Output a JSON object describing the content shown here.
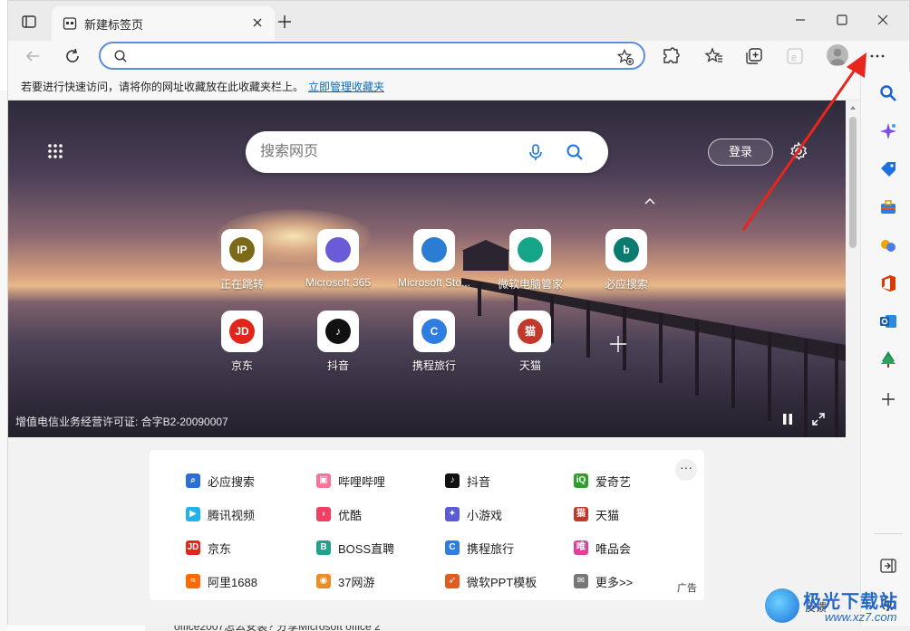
{
  "tab": {
    "title": "新建标签页"
  },
  "addressbar": {
    "value": "",
    "placeholder": ""
  },
  "favorites_hint": {
    "message": "若要进行快速访问，请将你的网址收藏放在此收藏夹栏上。",
    "link": "立即管理收藏夹"
  },
  "search": {
    "placeholder": "搜索网页"
  },
  "login_label": "登录",
  "tiles": [
    {
      "label": "正在跳转",
      "icon": "ip-icon",
      "text": "IP",
      "color": "#7a6a1a"
    },
    {
      "label": "Microsoft 365",
      "icon": "m365-icon",
      "text": "",
      "color": "#6a5cd6"
    },
    {
      "label": "Microsoft Sto...",
      "icon": "store-icon",
      "text": "",
      "color": "#2b7cd3"
    },
    {
      "label": "微软电脑管家",
      "icon": "pc-manager-icon",
      "text": "",
      "color": "#17a589"
    },
    {
      "label": "必应搜索",
      "icon": "bing-icon",
      "text": "b",
      "color": "#0b7a6f"
    },
    {
      "label": "京东",
      "icon": "jd-icon",
      "text": "JD",
      "color": "#e1251b"
    },
    {
      "label": "抖音",
      "icon": "douyin-icon",
      "text": "♪",
      "color": "#111111"
    },
    {
      "label": "携程旅行",
      "icon": "ctrip-icon",
      "text": "C",
      "color": "#2f7de1"
    },
    {
      "label": "天猫",
      "icon": "tmall-icon",
      "text": "猫",
      "color": "#c0392b"
    }
  ],
  "license": "增值电信业务经营许可证: 合字B2-20090007",
  "links": [
    {
      "label": "必应搜索",
      "icon": "search-icon",
      "color": "#2b6fd6",
      "glyph": "⌕"
    },
    {
      "label": "哔哩哔哩",
      "icon": "bilibili-icon",
      "color": "#fb7299",
      "glyph": "▣"
    },
    {
      "label": "抖音",
      "icon": "douyin-icon",
      "color": "#111111",
      "glyph": "♪"
    },
    {
      "label": "爱奇艺",
      "icon": "iqiyi-icon",
      "color": "#2ca02c",
      "glyph": "iQ"
    },
    {
      "label": "腾讯视频",
      "icon": "tencent-video-icon",
      "color": "#20b2e8",
      "glyph": "▶"
    },
    {
      "label": "优酷",
      "icon": "youku-icon",
      "color": "#ef3f63",
      "glyph": "›"
    },
    {
      "label": "小游戏",
      "icon": "game-icon",
      "color": "#5b5bd6",
      "glyph": "✦"
    },
    {
      "label": "天猫",
      "icon": "tmall-icon",
      "color": "#c0392b",
      "glyph": "猫"
    },
    {
      "label": "京东",
      "icon": "jd-icon",
      "color": "#e1251b",
      "glyph": "JD"
    },
    {
      "label": "BOSS直聘",
      "icon": "boss-icon",
      "color": "#1fa38a",
      "glyph": "B"
    },
    {
      "label": "携程旅行",
      "icon": "ctrip-icon",
      "color": "#2f7de1",
      "glyph": "C"
    },
    {
      "label": "唯品会",
      "icon": "vip-icon",
      "color": "#e0409a",
      "glyph": "唯"
    },
    {
      "label": "阿里1688",
      "icon": "ali1688-icon",
      "color": "#ff6a00",
      "glyph": "≈"
    },
    {
      "label": "37网游",
      "icon": "37-icon",
      "color": "#f08a24",
      "glyph": "◉"
    },
    {
      "label": "微软PPT模板",
      "icon": "ppt-icon",
      "color": "#e25b1f",
      "glyph": "➶"
    },
    {
      "label": "更多>>",
      "icon": "more-links-icon",
      "color": "#777777",
      "glyph": "✉"
    }
  ],
  "ad_label": "广告",
  "more_label": "···",
  "watermark": {
    "name": "极光下载站",
    "url": "www.xz7.com"
  },
  "feedback": "反馈",
  "bottom_text": "office2007怎么安装? 分享Microsoft office 2"
}
